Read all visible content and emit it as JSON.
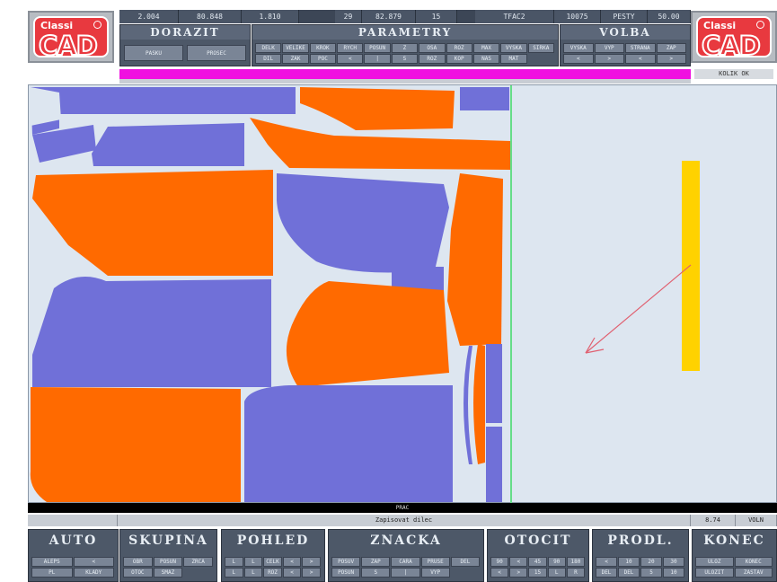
{
  "app": {
    "logo_text_top": "Classi",
    "logo_text_main": "CAD"
  },
  "stats": [
    "2.004",
    "80.848",
    "1.810",
    "29",
    "82.879",
    "15",
    "TFAC2",
    "10075",
    "PESTY",
    "50.00"
  ],
  "panels": {
    "dorazit": {
      "title": "DORAZIT",
      "buttons": [
        "PASKU",
        "PROSEC"
      ]
    },
    "parametry": {
      "title": "PARAMETRY",
      "buttons": [
        "DELK",
        "VELIKE",
        "KROK",
        "RYCH",
        "POSUN",
        "Z",
        "OSA",
        "ROZ",
        "MAX",
        "VYSKA",
        "SIRKA",
        "DIL",
        "ZAK",
        "POC",
        "<",
        "|",
        "S",
        "ROZ",
        "KOP",
        "NAS",
        "MAT"
      ]
    },
    "volba": {
      "title": "VOLBA",
      "buttons": [
        "VYSKA",
        "VYP",
        "STRANA",
        "ZAP",
        "<",
        ">",
        "<",
        ">"
      ]
    }
  },
  "status": {
    "right_label": "KOLIK OK"
  },
  "canvas": {
    "bottom_label": "PRAC"
  },
  "colors": {
    "orange": "#ff6a00",
    "purple": "#7070d8",
    "yellow": "#ffd200",
    "canvas": "#dde6f0",
    "magenta": "#f010e0",
    "green_line": "#66dd88",
    "arrow": "#e06070"
  },
  "infobar": {
    "left": "",
    "center": "Zapisovat dilec",
    "r1": "8.74",
    "r2": "VOLN"
  },
  "bottom": {
    "auto": {
      "title": "AUTO",
      "buttons": [
        "ALEPS",
        "<",
        "PL",
        "KLADY"
      ]
    },
    "skupina": {
      "title": "SKUPINA",
      "buttons": [
        "OBR",
        "POSUN",
        "ZRCA",
        "OTOC",
        "SMAZ"
      ]
    },
    "pohled": {
      "title": "POHLED",
      "buttons": [
        "L",
        "L",
        "CELK",
        "<",
        ">",
        "L",
        "L",
        "ROZ",
        "<",
        ">"
      ]
    },
    "znacka": {
      "title": "ZNACKA",
      "buttons": [
        "POSUV",
        "ZAP",
        "CARA",
        "PRUSE",
        "DEL",
        "POSUN",
        "S",
        "|",
        "VYP"
      ]
    },
    "otocit": {
      "title": "OTOCIT",
      "buttons": [
        "90",
        "<",
        "45",
        "90",
        "180",
        "<",
        ">",
        "15",
        "L",
        "R"
      ]
    },
    "prodl": {
      "title": "PRODL.",
      "buttons": [
        "<",
        "10",
        "20",
        "30",
        "DEL",
        "DEL",
        "5",
        "10"
      ]
    },
    "konec": {
      "title": "KONEC",
      "buttons": [
        "ULOZ",
        "KONEC",
        "ULOZIT",
        "ZASTAV"
      ]
    }
  }
}
